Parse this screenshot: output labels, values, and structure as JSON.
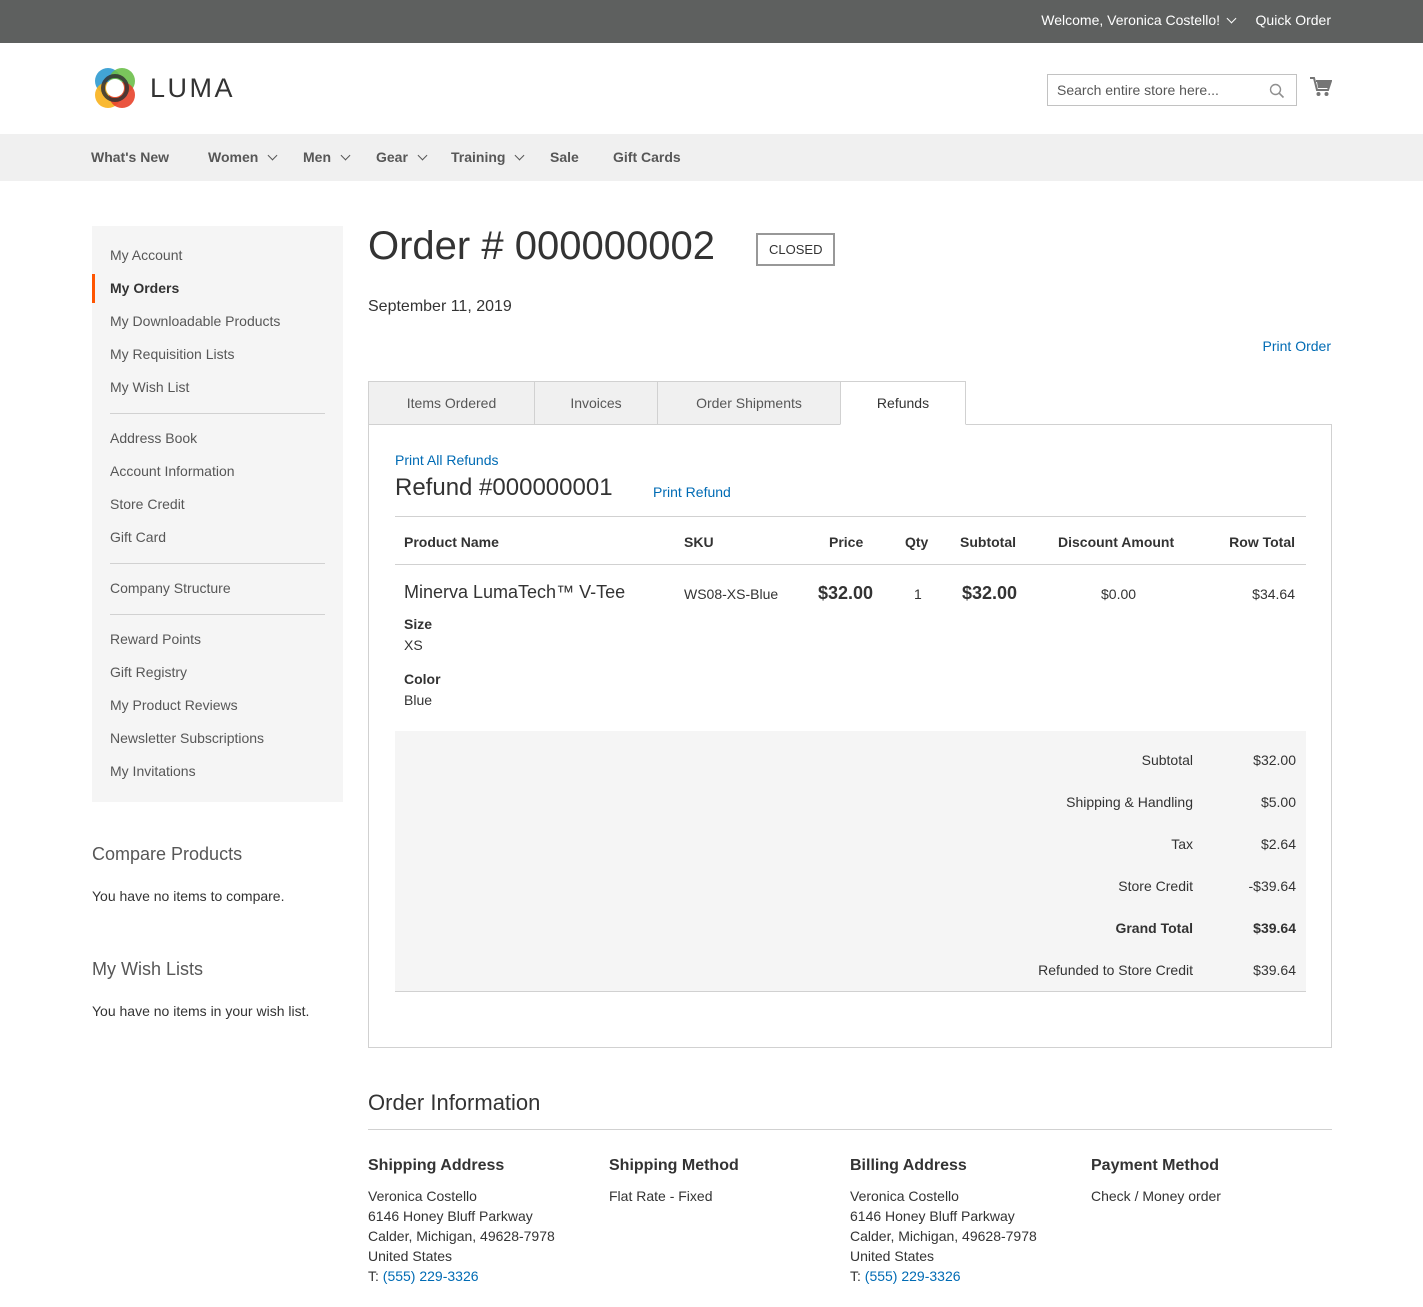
{
  "top_panel": {
    "welcome": "Welcome, Veronica Costello!",
    "quick_order": "Quick Order"
  },
  "header": {
    "logo_text": "LUMA",
    "search_placeholder": "Search entire store here...",
    "cart_icon": "cart-icon",
    "search_icon": "search-icon"
  },
  "nav": [
    "What's New",
    "Women",
    "Men",
    "Gear",
    "Training",
    "Sale",
    "Gift Cards"
  ],
  "sidebar": {
    "items": [
      "My Account",
      "My Orders",
      "My Downloadable Products",
      "My Requisition Lists",
      "My Wish List",
      "Address Book",
      "Account Information",
      "Store Credit",
      "Gift Card",
      "Company Structure",
      "Reward Points",
      "Gift Registry",
      "My Product Reviews",
      "Newsletter Subscriptions",
      "My Invitations"
    ],
    "active": "My Orders"
  },
  "compare": {
    "title": "Compare Products",
    "text": "You have no items to compare."
  },
  "wishlists": {
    "title": "My Wish Lists",
    "text": "You have no items in your wish list."
  },
  "order": {
    "title": "Order # 000000002",
    "status": "CLOSED",
    "date": "September 11, 2019",
    "print_order": "Print Order"
  },
  "tabs": [
    "Items Ordered",
    "Invoices",
    "Order Shipments",
    "Refunds"
  ],
  "active_tab": "Refunds",
  "refund": {
    "print_all": "Print All Refunds",
    "title": "Refund #000000001",
    "print_refund": "Print Refund",
    "columns": [
      "Product Name",
      "SKU",
      "Price",
      "Qty",
      "Subtotal",
      "Discount Amount",
      "Row Total"
    ],
    "item": {
      "name": "Minerva LumaTech™ V-Tee",
      "sku": "WS08-XS-Blue",
      "price": "$32.00",
      "qty": "1",
      "subtotal": "$32.00",
      "discount": "$0.00",
      "row_total": "$34.64",
      "options": [
        {
          "label": "Size",
          "value": "XS"
        },
        {
          "label": "Color",
          "value": "Blue"
        }
      ]
    },
    "totals": [
      {
        "label": "Subtotal",
        "value": "$32.00"
      },
      {
        "label": "Shipping & Handling",
        "value": "$5.00"
      },
      {
        "label": "Tax",
        "value": "$2.64"
      },
      {
        "label": "Store Credit",
        "value": "-$39.64"
      },
      {
        "label": "Grand Total",
        "value": "$39.64"
      },
      {
        "label": "Refunded to Store Credit",
        "value": "$39.64"
      }
    ]
  },
  "order_info": {
    "title": "Order Information",
    "shipping_address": {
      "title": "Shipping Address",
      "lines": [
        "Veronica Costello",
        "6146 Honey Bluff Parkway",
        "Calder, Michigan, 49628-7978",
        "United States"
      ],
      "phone_prefix": "T:",
      "phone": "(555) 229-3326"
    },
    "shipping_method": {
      "title": "Shipping Method",
      "value": "Flat Rate - Fixed"
    },
    "billing_address": {
      "title": "Billing Address",
      "lines": [
        "Veronica Costello",
        "6146 Honey Bluff Parkway",
        "Calder, Michigan, 49628-7978",
        "United States"
      ],
      "phone_prefix": "T:",
      "phone": "(555) 229-3326"
    },
    "payment_method": {
      "title": "Payment Method",
      "value": "Check / Money order"
    }
  }
}
